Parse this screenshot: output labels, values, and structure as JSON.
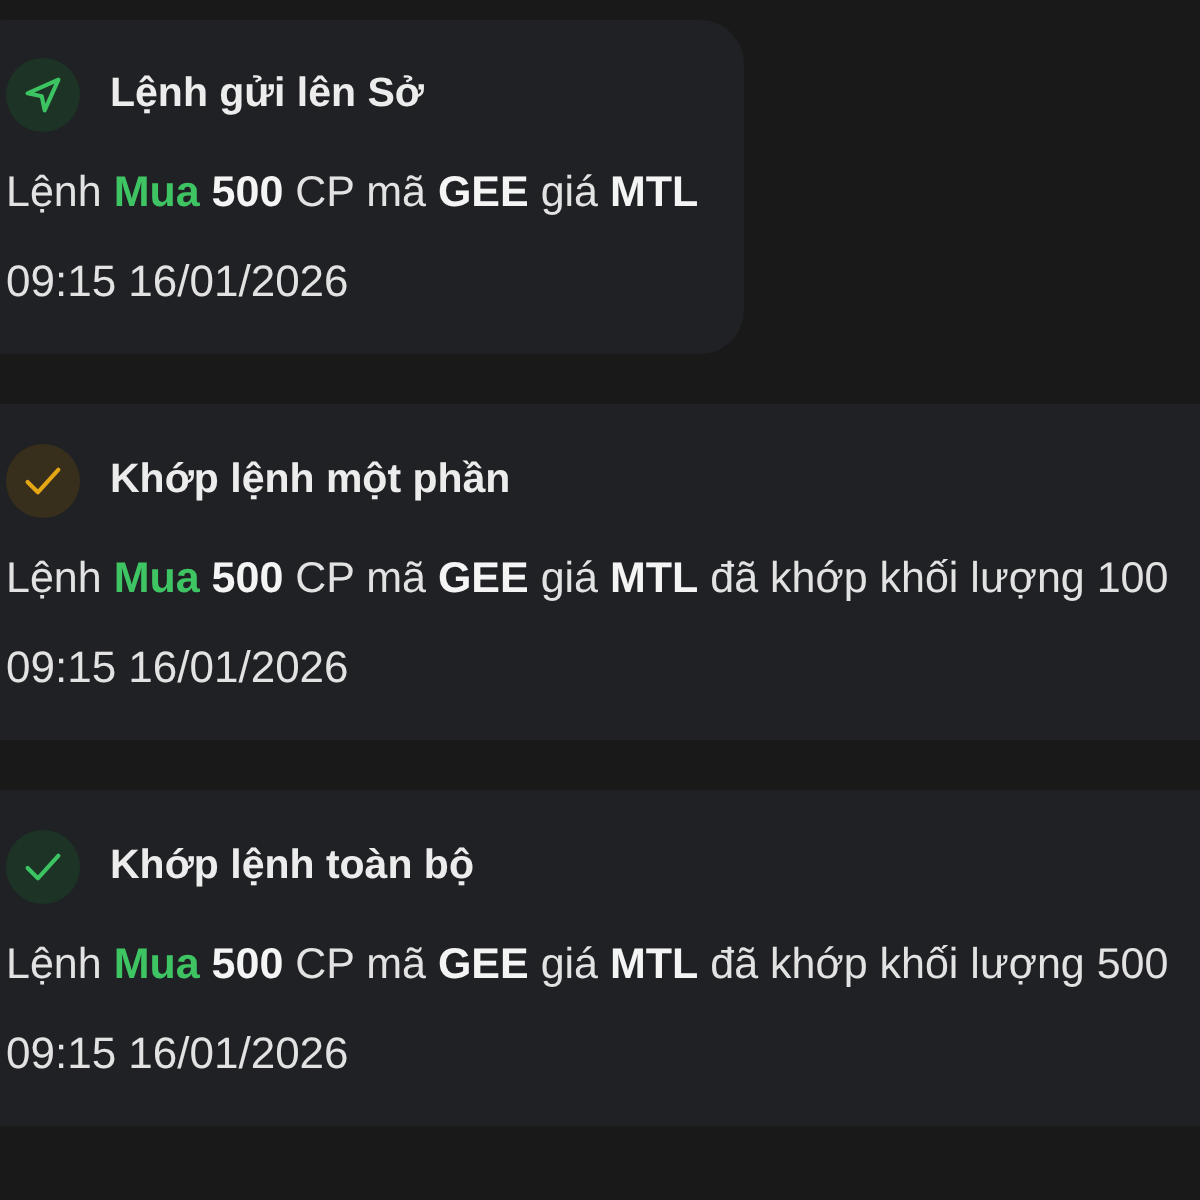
{
  "notifications": [
    {
      "kind": "sent",
      "highlighted": true,
      "title": "Lệnh gửi lên Sở",
      "message": [
        {
          "kind": "plain",
          "text": "Lệnh "
        },
        {
          "kind": "side",
          "text": "Mua"
        },
        {
          "kind": "bold",
          "text": " 500"
        },
        {
          "kind": "plain",
          "text": " CP mã "
        },
        {
          "kind": "bold",
          "text": "GEE"
        },
        {
          "kind": "plain",
          "text": " giá "
        },
        {
          "kind": "bold",
          "text": "MTL"
        }
      ],
      "time": "09:15 16/01/2026"
    },
    {
      "kind": "partial",
      "highlighted": false,
      "title": "Khớp lệnh một phần",
      "message": [
        {
          "kind": "plain",
          "text": "Lệnh "
        },
        {
          "kind": "side",
          "text": "Mua"
        },
        {
          "kind": "bold",
          "text": " 500"
        },
        {
          "kind": "plain",
          "text": " CP mã "
        },
        {
          "kind": "bold",
          "text": "GEE"
        },
        {
          "kind": "plain",
          "text": " giá "
        },
        {
          "kind": "bold",
          "text": "MTL"
        },
        {
          "kind": "plain",
          "text": " đã khớp khối lượng 100"
        }
      ],
      "time": "09:15 16/01/2026"
    },
    {
      "kind": "filled",
      "highlighted": false,
      "title": "Khớp lệnh toàn bộ",
      "message": [
        {
          "kind": "plain",
          "text": "Lệnh "
        },
        {
          "kind": "side",
          "text": "Mua"
        },
        {
          "kind": "bold",
          "text": " 500"
        },
        {
          "kind": "plain",
          "text": " CP mã "
        },
        {
          "kind": "bold",
          "text": "GEE"
        },
        {
          "kind": "plain",
          "text": " giá "
        },
        {
          "kind": "bold",
          "text": "MTL"
        },
        {
          "kind": "plain",
          "text": " đã khớp khối lượng 500"
        }
      ],
      "time": "09:15 16/01/2026"
    }
  ]
}
